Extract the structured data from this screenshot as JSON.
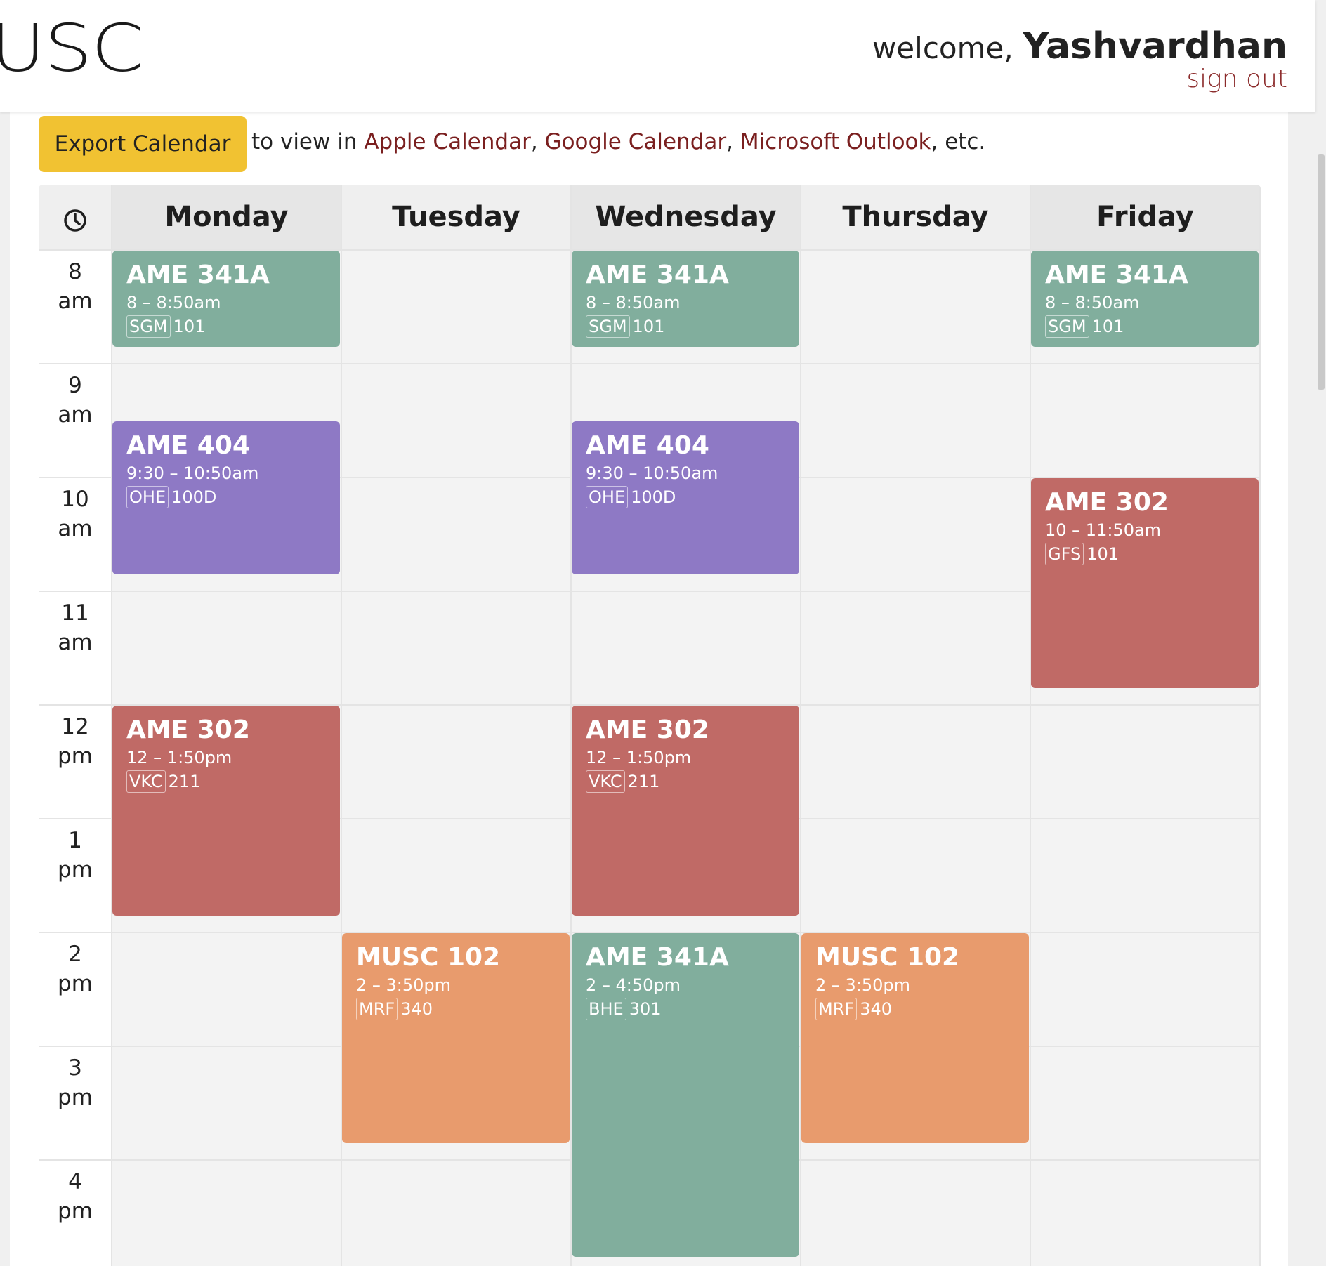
{
  "header": {
    "logo": "USC",
    "welcome_prefix": "welcome, ",
    "username": "Yashvardhan",
    "signout": "sign out"
  },
  "toolbar": {
    "export_label": "Export Calendar",
    "to_view_text": "to view in ",
    "links": [
      "Apple Calendar",
      "Google Calendar",
      "Microsoft Outlook"
    ],
    "sep": ", ",
    "etc": ", etc."
  },
  "calendar": {
    "clock_icon": "clock-icon",
    "days": [
      "Monday",
      "Tuesday",
      "Wednesday",
      "Thursday",
      "Friday"
    ],
    "hours": [
      {
        "num": "8",
        "ampm": "am"
      },
      {
        "num": "9",
        "ampm": "am"
      },
      {
        "num": "10",
        "ampm": "am"
      },
      {
        "num": "11",
        "ampm": "am"
      },
      {
        "num": "12",
        "ampm": "pm"
      },
      {
        "num": "1",
        "ampm": "pm"
      },
      {
        "num": "2",
        "ampm": "pm"
      },
      {
        "num": "3",
        "ampm": "pm"
      },
      {
        "num": "4",
        "ampm": "pm"
      }
    ],
    "colors": {
      "green": "#81ae9d",
      "purple": "#8e79c5",
      "red": "#c06a66",
      "orange": "#e89b6d"
    },
    "events": [
      {
        "day": 0,
        "start": 8,
        "end": 8.8333,
        "course": "AME 341A",
        "time": "8 – 8:50am",
        "building": "SGM",
        "room": "101",
        "color": "green"
      },
      {
        "day": 2,
        "start": 8,
        "end": 8.8333,
        "course": "AME 341A",
        "time": "8 – 8:50am",
        "building": "SGM",
        "room": "101",
        "color": "green"
      },
      {
        "day": 4,
        "start": 8,
        "end": 8.8333,
        "course": "AME 341A",
        "time": "8 – 8:50am",
        "building": "SGM",
        "room": "101",
        "color": "green"
      },
      {
        "day": 0,
        "start": 9.5,
        "end": 10.8333,
        "course": "AME 404",
        "time": "9:30 – 10:50am",
        "building": "OHE",
        "room": "100D",
        "color": "purple"
      },
      {
        "day": 2,
        "start": 9.5,
        "end": 10.8333,
        "course": "AME 404",
        "time": "9:30 – 10:50am",
        "building": "OHE",
        "room": "100D",
        "color": "purple"
      },
      {
        "day": 4,
        "start": 10,
        "end": 11.8333,
        "course": "AME 302",
        "time": "10 – 11:50am",
        "building": "GFS",
        "room": "101",
        "color": "red"
      },
      {
        "day": 0,
        "start": 12,
        "end": 13.8333,
        "course": "AME 302",
        "time": "12 – 1:50pm",
        "building": "VKC",
        "room": "211",
        "color": "red"
      },
      {
        "day": 2,
        "start": 12,
        "end": 13.8333,
        "course": "AME 302",
        "time": "12 – 1:50pm",
        "building": "VKC",
        "room": "211",
        "color": "red"
      },
      {
        "day": 1,
        "start": 14,
        "end": 15.8333,
        "course": "MUSC 102",
        "time": "2 – 3:50pm",
        "building": "MRF",
        "room": "340",
        "color": "orange"
      },
      {
        "day": 2,
        "start": 14,
        "end": 16.8333,
        "course": "AME 341A",
        "time": "2 – 4:50pm",
        "building": "BHE",
        "room": "301",
        "color": "green"
      },
      {
        "day": 3,
        "start": 14,
        "end": 15.8333,
        "course": "MUSC 102",
        "time": "2 – 3:50pm",
        "building": "MRF",
        "room": "340",
        "color": "orange"
      }
    ]
  }
}
